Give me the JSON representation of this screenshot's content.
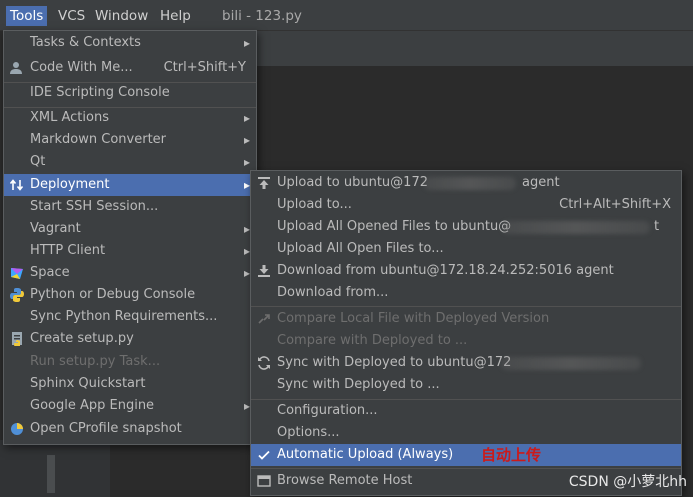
{
  "menubar": {
    "items": [
      "Tools",
      "VCS",
      "Window",
      "Help"
    ],
    "title": "bili - 123.py"
  },
  "tools_menu": {
    "items": [
      {
        "label": "Tasks & Contexts",
        "submenu": true
      },
      {
        "label": "Code With Me...",
        "shortcut": "Ctrl+Shift+Y",
        "icon": "user-icon"
      },
      {
        "label": "IDE Scripting Console"
      },
      {
        "label": "XML Actions",
        "submenu": true
      },
      {
        "label": "Markdown Converter",
        "submenu": true
      },
      {
        "label": "Qt",
        "submenu": true
      },
      {
        "label": "Deployment",
        "submenu": true,
        "selected": true,
        "icon": "deployment-icon"
      },
      {
        "label": "Start SSH Session..."
      },
      {
        "label": "Vagrant",
        "submenu": true
      },
      {
        "label": "HTTP Client",
        "submenu": true
      },
      {
        "label": "Space",
        "submenu": true,
        "icon": "space-icon"
      },
      {
        "label": "Python or Debug Console",
        "icon": "python-icon"
      },
      {
        "label": "Sync Python Requirements..."
      },
      {
        "label": "Create setup.py",
        "icon": "setup-icon"
      },
      {
        "label": "Run setup.py Task...",
        "disabled": true
      },
      {
        "label": "Sphinx Quickstart"
      },
      {
        "label": "Google App Engine",
        "submenu": true
      },
      {
        "label": "Open CProfile snapshot",
        "icon": "profile-icon"
      }
    ]
  },
  "deployment_menu": {
    "items": [
      {
        "label": "Upload to ubuntu@172",
        "suffix": "agent",
        "icon": "upload-icon"
      },
      {
        "label": "Upload to...",
        "shortcut": "Ctrl+Alt+Shift+X"
      },
      {
        "label": "Upload All Opened Files to ubuntu@",
        "suffix": "t"
      },
      {
        "label": "Upload All Open Files to..."
      },
      {
        "label": "Download from ubuntu@172.18.24.252:5016 agent",
        "icon": "download-icon"
      },
      {
        "label": "Download from..."
      },
      {
        "label": "Compare Local File with Deployed Version",
        "disabled": true,
        "icon": "compare-icon"
      },
      {
        "label": "Compare with Deployed to ...",
        "disabled": true
      },
      {
        "label": "Sync with Deployed to ubuntu@172",
        "icon": "sync-icon"
      },
      {
        "label": "Sync with Deployed to ..."
      },
      {
        "label": "Configuration..."
      },
      {
        "label": "Options..."
      },
      {
        "label": "Automatic Upload (Always)",
        "selected": true,
        "checked": true,
        "note": "自动上传"
      },
      {
        "label": "Browse Remote Host",
        "icon": "browse-icon"
      }
    ]
  },
  "watermark": "CSDN @小萝北hh",
  "colors": {
    "menubar_bg": "#3c3f41",
    "menu_bg": "#3c3f41",
    "selection": "#4b6eaf",
    "text": "#bbbbbb",
    "disabled_text": "#6e6e6e",
    "note_red": "#cc1a1a"
  }
}
